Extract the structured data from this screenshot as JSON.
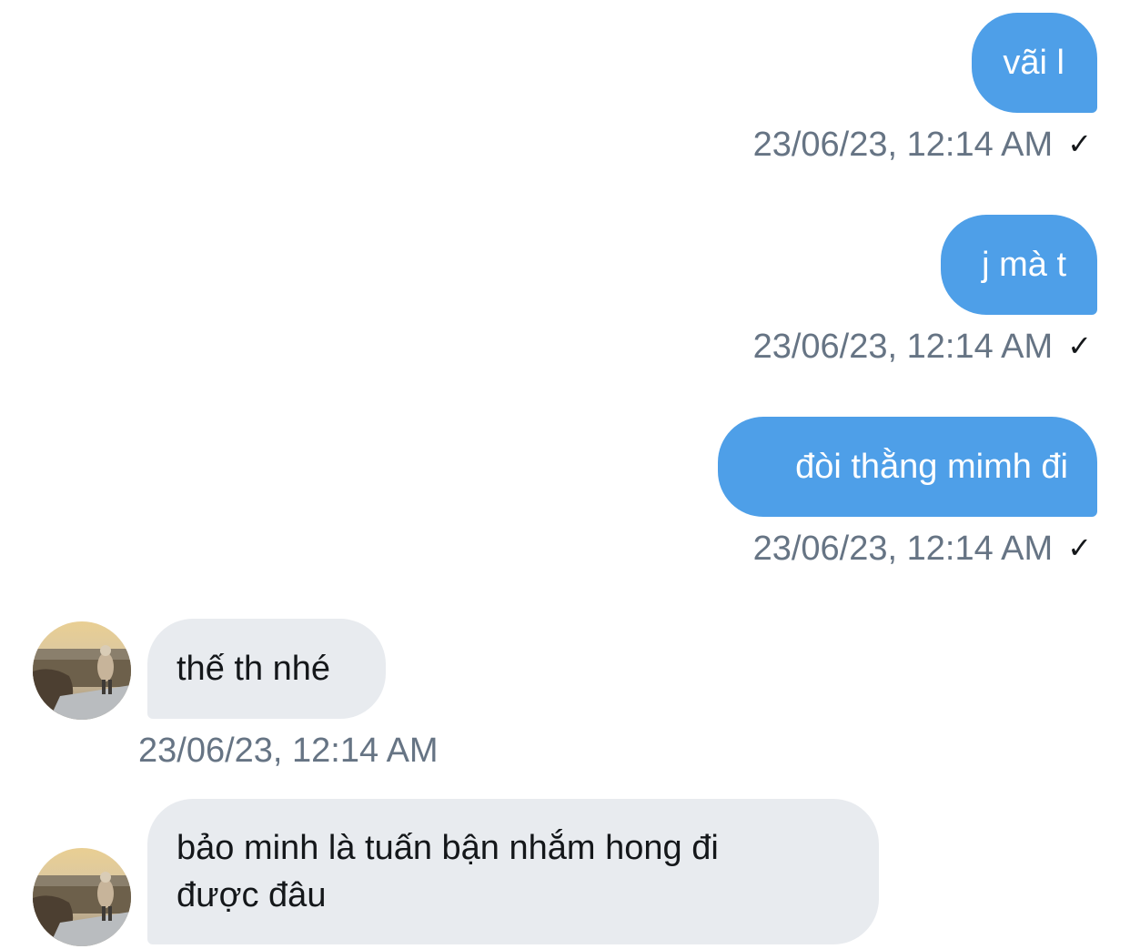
{
  "messages": [
    {
      "direction": "outgoing",
      "text": "vãi l",
      "timestamp": "23/06/23, 12:14 AM",
      "status_icon": "check-icon"
    },
    {
      "direction": "outgoing",
      "text": "j mà t",
      "timestamp": "23/06/23, 12:14 AM",
      "status_icon": "check-icon"
    },
    {
      "direction": "outgoing",
      "text": "đòi thằng mimh đi",
      "timestamp": "23/06/23, 12:14 AM",
      "status_icon": "check-icon"
    },
    {
      "direction": "incoming",
      "text": "thế th nhé",
      "timestamp": "23/06/23, 12:14 AM"
    },
    {
      "direction": "incoming",
      "text_line1": "bảo minh là tuấn bận nhắm hong đi",
      "text_line2": "được đâu"
    }
  ],
  "check_glyph": "✓",
  "colors": {
    "outgoing_bubble": "#4e9fe8",
    "incoming_bubble": "#e8ebef",
    "timestamp": "#667484",
    "text": "#14171a"
  }
}
